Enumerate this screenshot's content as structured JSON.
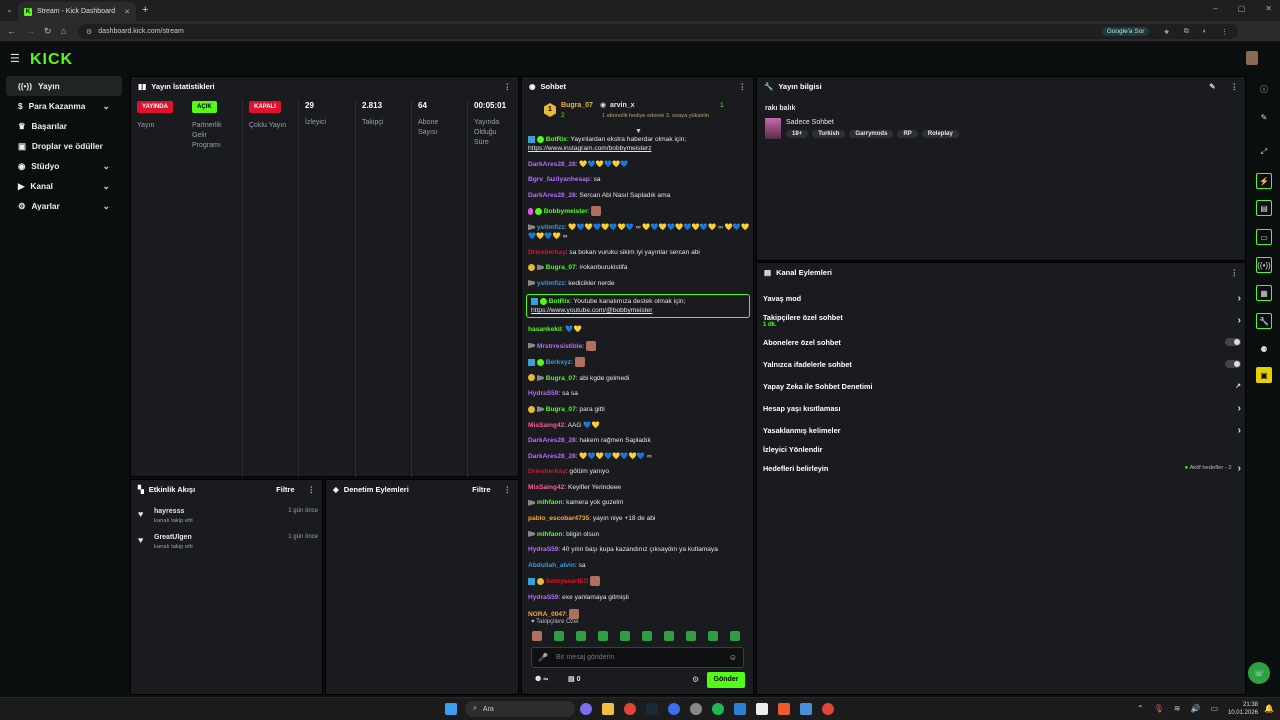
{
  "browser": {
    "tab_title": "Stream - Kick Dashboard",
    "url": "dashboard.kick.com/stream",
    "google_ask": "Google'a Sor"
  },
  "logo": "KICK",
  "sidebar": {
    "items": [
      {
        "label": "Yayın",
        "icon": "broadcast-icon",
        "chevron": false
      },
      {
        "label": "Para Kazanma",
        "icon": "money-icon",
        "chevron": true
      },
      {
        "label": "Başarılar",
        "icon": "trophy-icon",
        "chevron": false
      },
      {
        "label": "Droplar ve ödüller",
        "icon": "gift-icon",
        "chevron": false
      },
      {
        "label": "Stüdyo",
        "icon": "studio-icon",
        "chevron": true
      },
      {
        "label": "Kanal",
        "icon": "channel-icon",
        "chevron": true
      },
      {
        "label": "Ayarlar",
        "icon": "gear-icon",
        "chevron": true
      }
    ]
  },
  "stats": {
    "title": "Yayın İstatistikleri",
    "badges": [
      {
        "badge": "YAYINDA",
        "label": "Yayın",
        "color": "#e0112b"
      },
      {
        "badge": "AÇIK",
        "label": "Partnerlik Gelir Programı",
        "color": "#53fc18"
      },
      {
        "badge": "KAPALI",
        "label": "Çoklu Yayın",
        "color": "#e0112b"
      }
    ],
    "values": [
      {
        "value": "29",
        "label": "İzleyici"
      },
      {
        "value": "2.813",
        "label": "Takipçi"
      },
      {
        "value": "64",
        "label": "Abone Sayısı"
      },
      {
        "value": "00:05:01",
        "label": "Yayında Olduğu Süre"
      }
    ]
  },
  "activity": {
    "title": "Etkinlik Akışı",
    "filter": "Filtre",
    "items": [
      {
        "name": "hayresss",
        "desc": "kanalı takip etti",
        "time": "1 gün önce"
      },
      {
        "name": "GreatUlgen",
        "desc": "kanalı takip etti",
        "time": "1 gün önce"
      }
    ]
  },
  "moderation": {
    "title": "Denetim Eylemleri",
    "filter": "Filtre"
  },
  "chat": {
    "title": "Sohbet",
    "pinned": {
      "user1": "Bugra_07",
      "count1": "2",
      "user2": "arvin_x",
      "count2": "1",
      "gift_text": "1 abonelik hediye ederek 3. sıraya yükselin"
    },
    "messages": [
      {
        "user": "BotRix",
        "color": "#53fc18",
        "text": ": Yayınlardan ekstra haberdar olmak için;",
        "link": "https://www.instagram.com/bobbymeisterz",
        "badges": [
          "bot",
          "verified"
        ]
      },
      {
        "user": "DarkAres28_28",
        "color": "#b86bff",
        "text": ": 💛💙💛💙💛💙"
      },
      {
        "user": "Bgrv_fazilyanhesap",
        "color": "#b86bff",
        "text": ": sa"
      },
      {
        "user": "DarkAres28_28",
        "color": "#b86bff",
        "text": ": Sercan Abi Nasıl Sapladık ama"
      },
      {
        "user": "Bobbymeister",
        "color": "#53fc18",
        "text": ":",
        "badges": [
          "pink",
          "verified"
        ],
        "emote": true
      },
      {
        "user": "ystimfizz",
        "color": "#3a9ad9",
        "text": ": 💛💙💛💙💛💙💛💙 ∞ 💛💙💛💙💛💙💛💙💛 ∞ 💛💙💛💙💛💙💛 ∞",
        "badges": [
          "mod"
        ]
      },
      {
        "user": "Driesberkay",
        "color": "#e0112b",
        "text": ": sa bokan vuruku sikim iyi yayınlar sercan abi"
      },
      {
        "user": "Bugra_07",
        "color": "#53fc18",
        "text": ": #okanburukistifa",
        "badges": [
          "gold",
          "mod"
        ]
      },
      {
        "user": "ystimfizz",
        "color": "#3a9ad9",
        "text": ": kedicikler nerde",
        "badges": [
          "mod"
        ]
      },
      {
        "user": "BotRix",
        "color": "#53fc18",
        "text": ": Youtube kanalımıza destek olmak için;",
        "link": "https://www.youtube.com/@bobbymeister",
        "badges": [
          "bot",
          "verified"
        ],
        "highlight": true
      },
      {
        "user": "hasankekil",
        "color": "#53fc18",
        "text": ": 💙💛"
      },
      {
        "user": "Mrstrresistible",
        "color": "#b86bff",
        "text": ":",
        "badges": [
          "mod"
        ],
        "emote": true
      },
      {
        "user": "Berkxyz",
        "color": "#3a9ad9",
        "text": ":",
        "badges": [
          "bot",
          "verified"
        ],
        "emote": true
      },
      {
        "user": "Bugra_07",
        "color": "#53fc18",
        "text": ": abi kgde gelmedi",
        "badges": [
          "gold",
          "mod"
        ]
      },
      {
        "user": "HydraS59",
        "color": "#b86bff",
        "text": ": sa sa"
      },
      {
        "user": "Bugra_07",
        "color": "#53fc18",
        "text": ": para gitti",
        "badges": [
          "gold",
          "mod"
        ]
      },
      {
        "user": "MisSaing42",
        "color": "#ff5aa0",
        "text": ": AAG 💙💛"
      },
      {
        "user": "DarkAres28_28",
        "color": "#b86bff",
        "text": ": hakem rağmen Sapladık"
      },
      {
        "user": "DarkAres28_28",
        "color": "#b86bff",
        "text": ": 💛💙💛💙💛💙💛💙 ∞"
      },
      {
        "user": "Driesberkay",
        "color": "#e0112b",
        "text": ": götüm yanıyo"
      },
      {
        "user": "MisSaing42",
        "color": "#ff5aa0",
        "text": ": Keyifler Yerindeee"
      },
      {
        "user": "mlhfaon",
        "color": "#53fc18",
        "text": ": kamera yok guzelm",
        "badges": [
          "mod"
        ]
      },
      {
        "user": "pablo_escobar4735",
        "color": "#ffa53a",
        "text": ": yayın niye +18 de abi"
      },
      {
        "user": "mlhfaon",
        "color": "#53fc18",
        "text": ": bilgin olsun",
        "badges": [
          "mod"
        ]
      },
      {
        "user": "HydraS59",
        "color": "#b86bff",
        "text": ": 40 yılın başı kupa kazandınız çıksaydın ya kutlamaya"
      },
      {
        "user": "Abdullah_alvin",
        "color": "#3a9ad9",
        "text": ": sa"
      },
      {
        "user": "Sentyuserl57",
        "color": "#e0112b",
        "text": ":",
        "badges": [
          "sq",
          "gold"
        ],
        "emote": true
      },
      {
        "user": "HydraS59",
        "color": "#b86bff",
        "text": ": exe yanlamaya gitmişti"
      },
      {
        "user": "NORA_0047",
        "color": "#ffa53a",
        "text": ":",
        "emote": true
      }
    ],
    "followers_only": "Takipçilere Özel",
    "placeholder": "Bir mesaj gönderin",
    "points": "∞",
    "kicks": "0",
    "send": "Gönder"
  },
  "stream_info": {
    "title": "Yayın bilgisi",
    "stream_title": "rakı balık",
    "category": "Sadece Sohbet",
    "tags": [
      "18+",
      "Turkish",
      "Garrymods",
      "RP",
      "Roleplay"
    ]
  },
  "channel_actions": {
    "title": "Kanal Eylemleri",
    "rows": [
      {
        "label": "Yavaş mod",
        "type": "chevron"
      },
      {
        "label": "Takipçilere özel sohbet",
        "sub": "1 dk.",
        "type": "chevron"
      },
      {
        "label": "Abonelere özel sohbet",
        "type": "toggle"
      },
      {
        "label": "Yalnızca ifadelerle sohbet",
        "type": "toggle"
      },
      {
        "label": "Yapay Zeka ile Sohbet Denetimi",
        "type": "external"
      },
      {
        "label": "Hesap yaşı kısıtlaması",
        "type": "chevron"
      },
      {
        "label": "Yasaklanmış kelimeler",
        "type": "chevron"
      },
      {
        "label": "İzleyici Yönlendir",
        "type": "none"
      },
      {
        "label": "Hedefleri belirleyin",
        "type": "chevron",
        "status": "Aktif hedefler - 2"
      }
    ]
  },
  "taskbar": {
    "search": "Ara",
    "time": "21:38",
    "date": "10.01.2026"
  }
}
